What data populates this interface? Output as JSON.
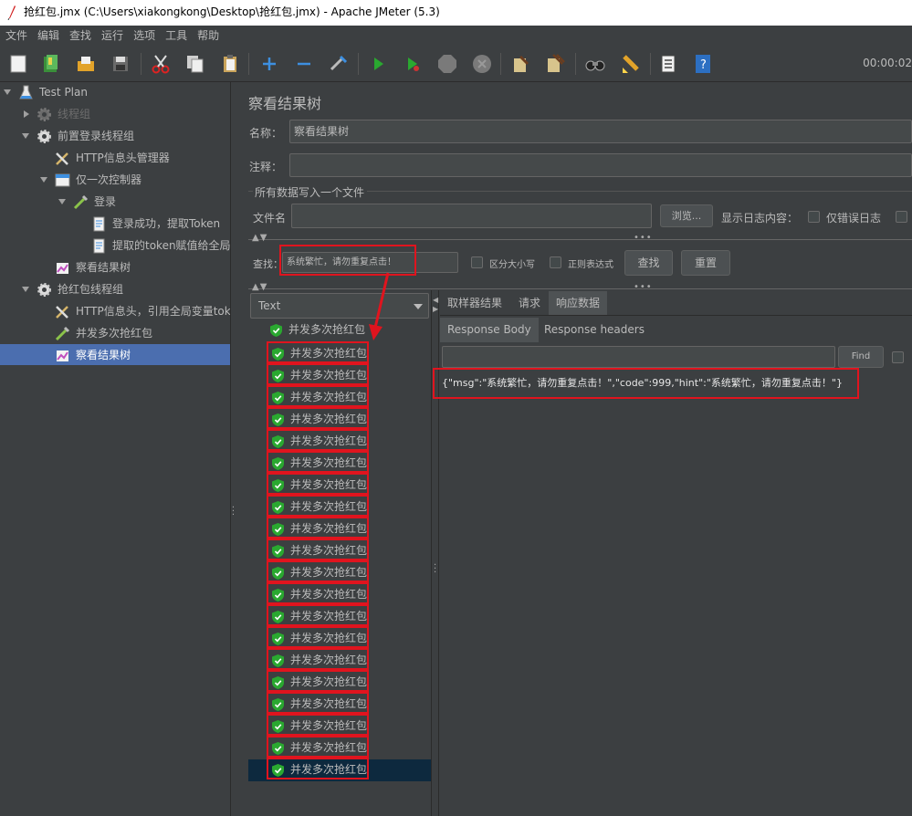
{
  "window": {
    "title": "抢红包.jmx (C:\\Users\\xiakongkong\\Desktop\\抢红包.jmx) - Apache JMeter (5.3)"
  },
  "menu": [
    "文件",
    "编辑",
    "查找",
    "运行",
    "选项",
    "工具",
    "帮助"
  ],
  "toolbar": {
    "timer": "00:00:02",
    "icons": [
      "new-icon",
      "templates-icon",
      "open-icon",
      "save-icon",
      "cut-icon",
      "copy-icon",
      "paste-icon",
      "expand-icon",
      "collapse-icon",
      "toggle-icon",
      "start-icon",
      "start-no-pause-icon",
      "stop-icon",
      "shutdown-icon",
      "clear-icon",
      "clear-all-icon",
      "search-icon",
      "reset-search-icon",
      "function-helper-icon",
      "help-icon"
    ]
  },
  "tree": {
    "nodes": [
      {
        "label": "Test Plan"
      },
      {
        "label": "线程组"
      },
      {
        "label": "前置登录线程组"
      },
      {
        "label": "HTTP信息头管理器"
      },
      {
        "label": "仅一次控制器"
      },
      {
        "label": "登录"
      },
      {
        "label": "登录成功，提取Token"
      },
      {
        "label": "提取的token赋值给全局变"
      },
      {
        "label": "察看结果树"
      },
      {
        "label": "抢红包线程组"
      },
      {
        "label": "HTTP信息头，引用全局变量toke"
      },
      {
        "label": "并发多次抢红包"
      },
      {
        "label": "察看结果树"
      }
    ]
  },
  "panel": {
    "title": "察看结果树",
    "name_label": "名称：",
    "name_value": "察看结果树",
    "comment_label": "注释：",
    "comment_value": "",
    "file_section": "所有数据写入一个文件",
    "filename_label": "文件名",
    "filename_value": "",
    "browse_button": "浏览...",
    "log_label": "显示日志内容：",
    "errors_only": "仅错误日志",
    "search_label": "查找：",
    "search_value": "系统繁忙，请勿重复点击！",
    "case_sensitive": "区分大小写",
    "regex": "正则表达式",
    "find_button": "查找",
    "reset_button": "重置",
    "renderer_value": "Text",
    "tabs": [
      "取样器结果",
      "请求",
      "响应数据"
    ],
    "subtabs": [
      "Response Body",
      "Response headers"
    ],
    "body_find_button": "Find",
    "response_body": "{\"msg\":\"系统繁忙，请勿重复点击！\",\"code\":999,\"hint\":\"系统繁忙，请勿重复点击！\"}"
  },
  "results": {
    "items": [
      {
        "label": "并发多次抢红包"
      },
      {
        "label": "并发多次抢红包"
      },
      {
        "label": "并发多次抢红包"
      },
      {
        "label": "并发多次抢红包"
      },
      {
        "label": "并发多次抢红包"
      },
      {
        "label": "并发多次抢红包"
      },
      {
        "label": "并发多次抢红包"
      },
      {
        "label": "并发多次抢红包"
      },
      {
        "label": "并发多次抢红包"
      },
      {
        "label": "并发多次抢红包"
      },
      {
        "label": "并发多次抢红包"
      },
      {
        "label": "并发多次抢红包"
      },
      {
        "label": "并发多次抢红包"
      },
      {
        "label": "并发多次抢红包"
      },
      {
        "label": "并发多次抢红包"
      },
      {
        "label": "并发多次抢红包"
      },
      {
        "label": "并发多次抢红包"
      },
      {
        "label": "并发多次抢红包"
      },
      {
        "label": "并发多次抢红包"
      },
      {
        "label": "并发多次抢红包"
      },
      {
        "label": "并发多次抢红包"
      }
    ]
  },
  "colors": {
    "background": "#3c3f41",
    "selection": "#4b6eaf",
    "highlight_box": "#e0141e",
    "success_green": "#2aa830"
  }
}
